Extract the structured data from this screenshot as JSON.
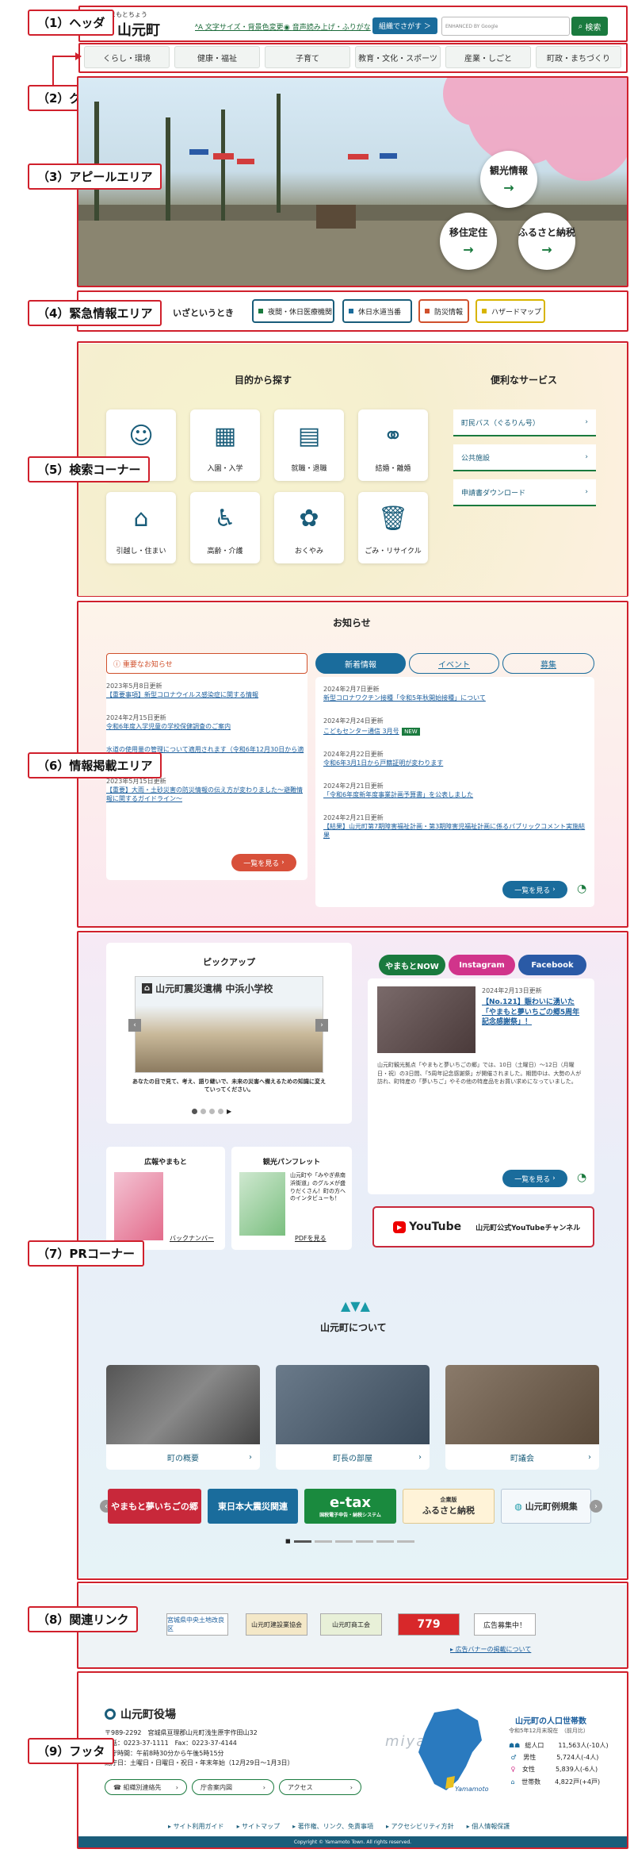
{
  "labels": {
    "l1": "（1）ヘッダ",
    "l2": "（2）グローバルナビゲーション",
    "l3": "（3）アピールエリア",
    "l4": "（4）緊急情報エリア",
    "l5": "（5）検索コーナー",
    "l6": "（6）情報掲載エリア",
    "l7": "（7）PRコーナー",
    "l8": "（8）関連リンク",
    "l9": "（9）フッタ"
  },
  "header": {
    "ruby": "やまもとちょう",
    "name": "山元町",
    "link1": "文字サイズ・背景色変更",
    "link2": "音声読み上げ・ふりがな",
    "lang": "組織でさがす ＞",
    "search_placeholder": "ENHANCED BY Google",
    "search_btn": "検索"
  },
  "nav": [
    "くらし・環境",
    "健康・福祉",
    "子育て",
    "教育・文化・スポーツ",
    "産業・しごと",
    "町政・まちづくり"
  ],
  "hero": {
    "c1": "観光情報",
    "c2": "移住定住",
    "c3": "ふるさと納税"
  },
  "emergency": {
    "title": "いざというとき",
    "items": [
      "夜間・休日医療機関",
      "休日水道当番",
      "防災情報",
      "ハザードマップ"
    ],
    "colors": [
      "#1a7a3e",
      "#1a6c9c",
      "#d0502c",
      "#d8b400"
    ]
  },
  "search": {
    "left_title": "目的から探す",
    "right_title": "便利なサービス",
    "cats": [
      "入園・入学",
      "就職・退職",
      "結婚・離婚",
      "引越し・住まい",
      "高齢・介護",
      "おくやみ",
      "ごみ・リサイクル"
    ],
    "services": [
      "町民バス（ぐるりん号）",
      "公共施設",
      "申請書ダウンロード"
    ]
  },
  "info": {
    "title": "お知らせ",
    "important": "重要なお知らせ",
    "imp_news": [
      {
        "date": "2023年5月8日更新",
        "title": "【重要事項】新型コロナウイルス感染症に関する情報"
      },
      {
        "date": "2024年2月15日更新",
        "title": "令和6年度入学児童の学校保健調査のご案内"
      },
      {
        "date": "",
        "title": "水道の使用量の管理について適用されます（令和6年12月30日から適用開始）"
      },
      {
        "date": "2023年5月15日更新",
        "title": "【重要】大雨・土砂災害の防災情報の伝え方が変わりました〜避難情報に関するガイドライン〜"
      }
    ],
    "tabs": [
      "新着情報",
      "イベント",
      "募集"
    ],
    "news": [
      {
        "date": "2024年2月7日更新",
        "title": "新型コロナワクチン接種「令和5年秋開始接種」について"
      },
      {
        "date": "2024年2月24日更新",
        "title": "こどもセンター通信 3月号"
      },
      {
        "date": "2024年2月22日更新",
        "title": "令和6年3月1日から戸籍証明が変わります"
      },
      {
        "date": "2024年2月21日更新",
        "title": "「令和6年度新年度事業計画予算書」を公表しました"
      },
      {
        "date": "2024年2月21日更新",
        "title": "【結果】山元町第7期障害福祉計画・第3期障害児福祉計画に係るパブリックコメント実施結果"
      }
    ],
    "new_badge": "NEW",
    "more_left": "一覧を見る",
    "more_right": "一覧を見る"
  },
  "pr": {
    "pickup": "ピックアップ",
    "pickup_slide_title": "山元町震災遺構 中浜小学校",
    "pickup_caption": "あなたの目で見て、考え、語り継いで、未来の災害へ備えるための知識に変えていってください。",
    "koho_title": "広報やまもと",
    "koho_link": "バックナンバー",
    "pamph_title": "観光パンフレット",
    "pamph_text": "山元町や「みやぎ県南浜街道」のグルメが盛りだくさん！町の方へのインタビューも！",
    "pamph_link": "PDFを見る",
    "sns_tabs": [
      "やまもとNOW",
      "Instagram",
      "Facebook"
    ],
    "sns_colors": [
      "#1a7a3e",
      "#d1348b",
      "#2a5aa6"
    ],
    "now_date": "2024年2月13日更新",
    "now_title": "【No.121】賑わいに湧いた「やまもと夢いちごの郷5周年記念感謝祭」！",
    "now_body": "山元町観光拠点「やまもと夢いちごの郷」では、10日（土曜日）〜12日（月曜日・祝）の3日間、「5周年記念感謝祭」が開催されました。期間中は、大勢の人が訪れ、町特産の「夢いちご」やその他の特産品をお買い求めになっていました。",
    "now_more": "一覧を見る",
    "youtube_logo": "YouTube",
    "youtube_text": "山元町公式YouTubeチャンネル",
    "about_title": "山元町について",
    "about_cards": [
      "町の概要",
      "町長の部屋",
      "町議会"
    ],
    "banners": [
      "やまもと夢いちごの郷",
      "東日本大震災関連",
      "e-tax",
      "ふるさと納税",
      "山元町例規集"
    ],
    "banner_sub": [
      "",
      "",
      "国税電子申告・納税システム",
      "企業版",
      ""
    ],
    "banner_colors": [
      "#c8283a",
      "#1a6c9c",
      "#1a8a3e",
      "#fff3d8",
      "#f4f8fb"
    ]
  },
  "links": {
    "banners": [
      "宮城県中央土地改良区",
      "山元町建設業協会",
      "山元町商工会",
      "779",
      "広告募集中！"
    ],
    "ad_link": "広告バナーの掲載について"
  },
  "footer": {
    "office": "山元町役場",
    "addr1": "〒989-2292　宮城県亘理郡山元町浅生原字作田山32",
    "addr2": "電話：0223-37-1111　Fax：0223-37-4144",
    "hours1": "開庁時間：午前8時30分から午後5時15分",
    "hours2": "閉庁日：土曜日・日曜日・祝日・年末年始（12月29日〜1月3日）",
    "btns": [
      "組織別連絡先",
      "庁舎案内図",
      "アクセス"
    ],
    "pop_title": "山元町の人口世帯数",
    "pop_sub": "令和5年12月末現在　（前月比）",
    "pop": [
      {
        "label": "総人口",
        "value": "11,563人(-10人)"
      },
      {
        "label": "男性",
        "value": "5,724人(-4人)"
      },
      {
        "label": "女性",
        "value": "5,839人(-6人)"
      },
      {
        "label": "世帯数",
        "value": "4,822戸(+4戸)"
      }
    ],
    "map_word": "miyagi",
    "map_town": "Yamamoto",
    "links": [
      "サイト利用ガイド",
      "サイトマップ",
      "著作権、リンク、免責事項",
      "アクセシビリティ方針",
      "個人情報保護"
    ],
    "copyright": "Copyright © Yamamoto Town. All rights reserved."
  }
}
